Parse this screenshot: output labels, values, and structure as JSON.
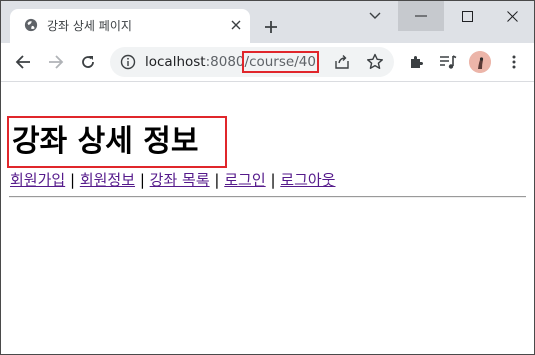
{
  "browser": {
    "tab": {
      "title": "강좌 상세 페이지"
    },
    "address": {
      "host": "localhost",
      "port": ":8080",
      "path": "/course/40"
    }
  },
  "page": {
    "heading": "강좌 상세 정보",
    "nav": [
      {
        "label": "회원가입"
      },
      {
        "label": "회원정보"
      },
      {
        "label": "강좌 목록"
      },
      {
        "label": "로그인"
      },
      {
        "label": "로그아웃"
      }
    ],
    "separator": "|"
  },
  "colors": {
    "highlight": "#e0262b",
    "visited_link": "#551a8b",
    "tabstrip": "#dee1e6"
  }
}
